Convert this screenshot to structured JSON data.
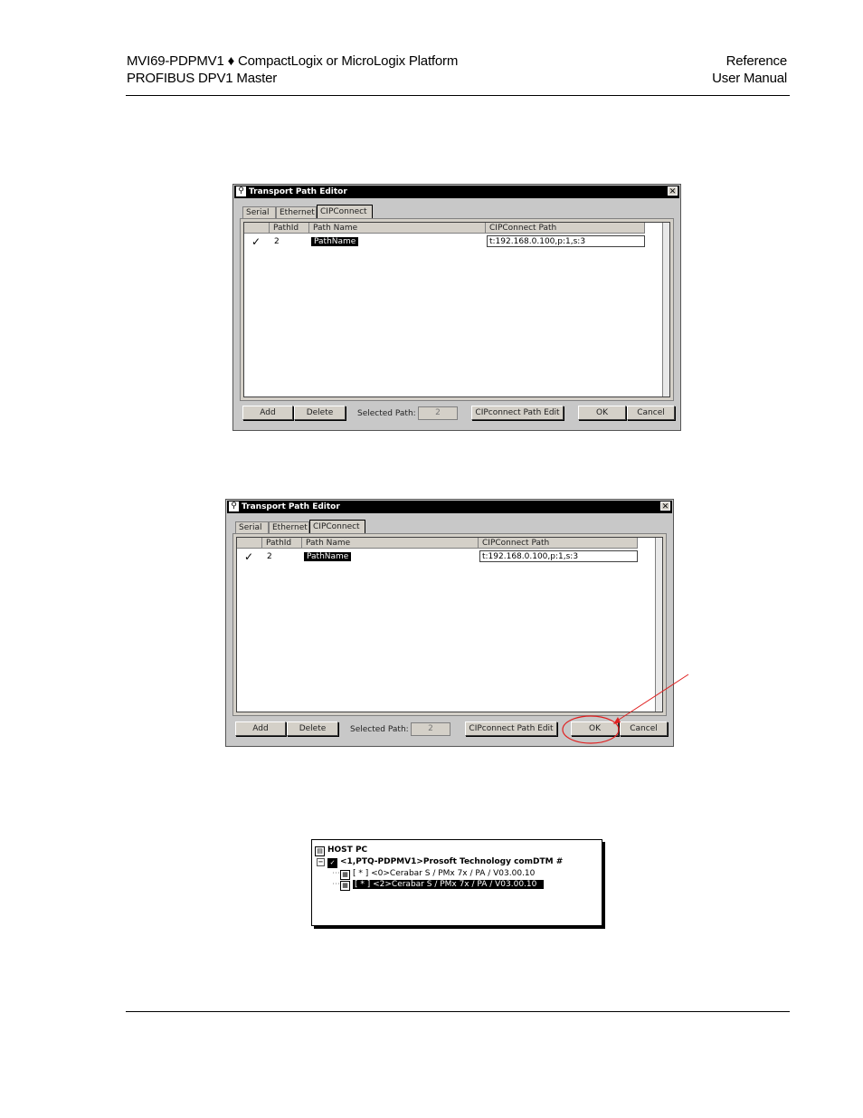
{
  "header": {
    "left_line1": "MVI69-PDPMV1 ♦ CompactLogix or MicroLogix Platform",
    "left_line2": "PROFIBUS DPV1 Master",
    "right_line1": "Reference",
    "right_line2": "User Manual"
  },
  "dialog": {
    "title": "Transport Path Editor",
    "title_icon": "magnifier-icon",
    "close_glyph": "✕",
    "tabs": [
      "Serial",
      "Ethernet",
      "CIPConnect"
    ],
    "active_tab": "CIPConnect",
    "columns": [
      "PathId",
      "Path Name",
      "CIPConnect Path"
    ],
    "row": {
      "check": "✓",
      "path_id": "2",
      "path_name": "PathName",
      "cip_path": "t:192.168.0.100,p:1,s:3"
    },
    "buttons": {
      "add": "Add",
      "delete": "Delete",
      "selected_path_label": "Selected Path:",
      "selected_path_value": "2",
      "cip_edit": "CIPconnect Path Edit",
      "ok": "OK",
      "cancel": "Cancel"
    }
  },
  "annotation_color": "#e02020",
  "tree": {
    "root": "HOST PC",
    "node": "<1,PTQ-PDPMV1>Prosoft Technology comDTM #",
    "children": [
      "[ * ] <0>Cerabar S / PMx 7x / PA / V03.00.10",
      "[ * ] <2>Cerabar S / PMx 7x / PA / V03.00.10"
    ]
  }
}
